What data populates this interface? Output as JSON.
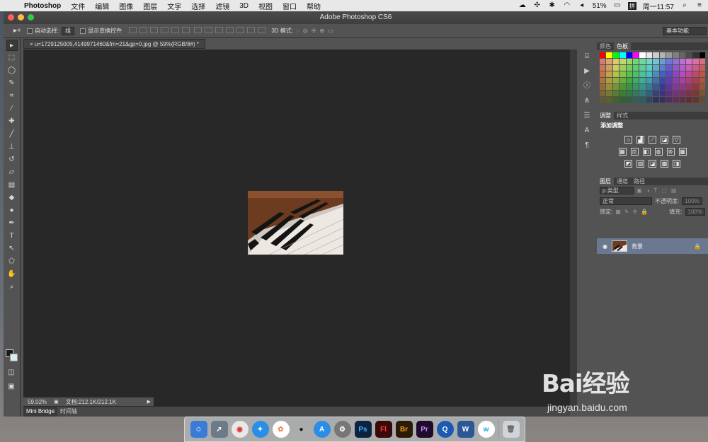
{
  "menubar": {
    "app_name": "Photoshop",
    "items": [
      "文件",
      "编辑",
      "图像",
      "图层",
      "文字",
      "选择",
      "滤镜",
      "3D",
      "视图",
      "窗口",
      "帮助"
    ],
    "battery": "51%",
    "input_method": "拼",
    "clock": "周一11:57"
  },
  "window": {
    "title": "Adobe Photoshop CS6"
  },
  "options_bar": {
    "auto_select_label": "自动选择:",
    "auto_select_value": "组",
    "show_transform_label": "显示变换控件",
    "mode_3d_label": "3D 模式:",
    "workspace": "基本功能"
  },
  "document": {
    "tab_title": "u=1729125005,4149971460&fm=21&gp=0.jpg @ 59%(RGB/8#) *",
    "zoom": "59.02%",
    "doc_size": "文档:212.1K/212.1K"
  },
  "bottom_tabs": [
    "Mini Bridge",
    "时间轴"
  ],
  "panels": {
    "color_tabs": [
      "颜色",
      "色板"
    ],
    "adjust_tabs": [
      "调整",
      "样式"
    ],
    "add_adjust": "添加调整",
    "layer_tabs": [
      "图层",
      "通道",
      "路径"
    ],
    "kind_filter": "ρ 类型",
    "blend_mode": "正常",
    "opacity_label": "不透明度:",
    "opacity_value": "100%",
    "lock_label": "锁定:",
    "fill_label": "填充:",
    "fill_value": "100%",
    "layer_name": "背景"
  },
  "watermark": {
    "logo": "Bai经验",
    "url": "jingyan.baidu.com"
  },
  "colors": {
    "accent": "#5a6a88"
  }
}
